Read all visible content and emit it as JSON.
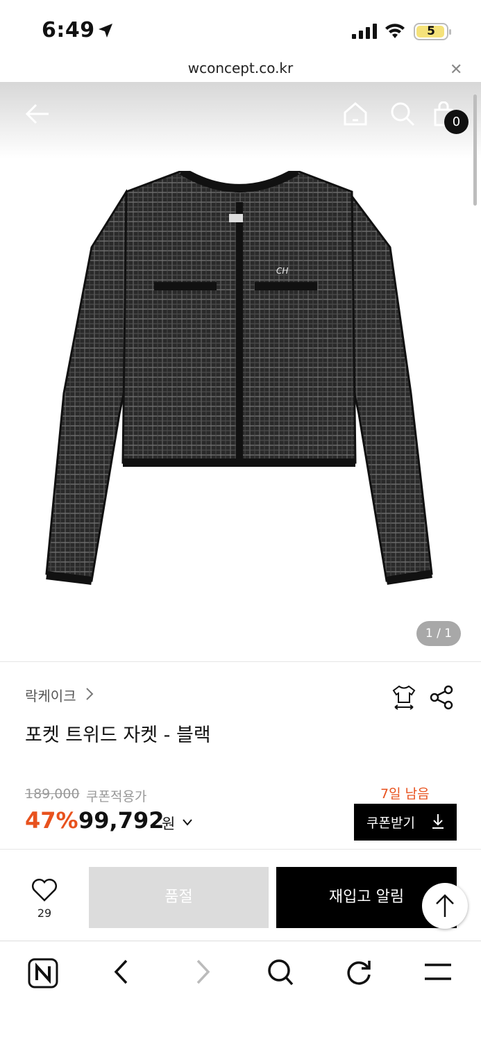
{
  "status_bar": {
    "time": "6:49",
    "battery": "5"
  },
  "browser": {
    "url": "wconcept.co.kr"
  },
  "header": {
    "cart_count": "0"
  },
  "gallery": {
    "counter": "1 / 1"
  },
  "product": {
    "brand": "락케이크",
    "title": "포켓 트위드 자켓 - 블랙",
    "original_price": "189,000",
    "coupon_note": "쿠폰적용가",
    "discount": "47%",
    "price": "99,792",
    "currency": "원",
    "days_left": "7일 남음",
    "coupon_button": "쿠폰받기"
  },
  "actions": {
    "like_count": "29",
    "sold_out": "품절",
    "restock_alert": "재입고 알림"
  },
  "colors": {
    "accent": "#e8521e",
    "black": "#000000",
    "disabled": "#dcdcdc"
  }
}
